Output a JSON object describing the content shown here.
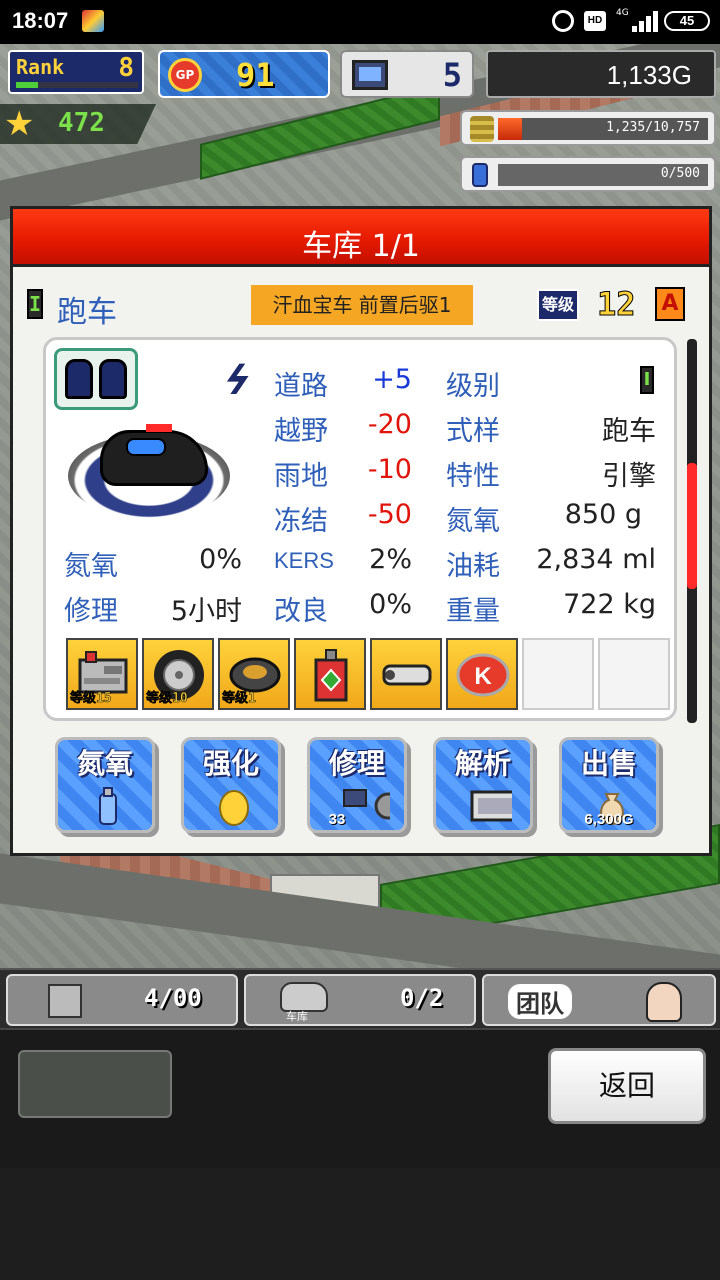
{
  "status_bar": {
    "time": "18:07",
    "hd": "HD",
    "network": "4G",
    "battery": "45"
  },
  "hud": {
    "rank_label": "Rank",
    "rank_value": "8",
    "rank_progress": 0.18,
    "gp_icon": "GP",
    "gp_value": "91",
    "pc_value": "5",
    "money": "1,133G",
    "stars": "472",
    "coins_bar": "1,235/10,757",
    "coins_fraction": 0.115,
    "fuel_bar": "0/500"
  },
  "dialog": {
    "title": "车库 1/1",
    "grade": "I",
    "car_type": "跑车",
    "car_name": "汗血宝车 前置后驱1",
    "level_label": "等级",
    "level_value": "12",
    "rank_letter": "A",
    "stats": {
      "road_label": "道路",
      "road_value": "+5",
      "offroad_label": "越野",
      "offroad_value": "-20",
      "rain_label": "雨地",
      "rain_value": "-10",
      "freeze_label": "冻结",
      "freeze_value": "-50",
      "class_label": "级别",
      "class_value": "I",
      "style_label": "式样",
      "style_value": "跑车",
      "feature_label": "特性",
      "feature_value": "引擎",
      "nitro_label": "氮氧",
      "nitro_value": "850 g",
      "nitro2_label": "氮氧",
      "nitro2_value": "0%",
      "repair_label": "修理",
      "repair_value": "5小时",
      "kers_label": "KERS",
      "kers_value": "2%",
      "improve_label": "改良",
      "improve_value": "0%",
      "fuel_label": "油耗",
      "fuel_value": "2,834 ml",
      "weight_label": "重量",
      "weight_value": "722 kg"
    },
    "parts": [
      {
        "icon": "engine-icon",
        "badge": "等级15"
      },
      {
        "icon": "wheel-icon",
        "badge": "等级10"
      },
      {
        "icon": "tire-part-icon",
        "badge": "等级1"
      },
      {
        "icon": "oil-can-icon",
        "badge": ""
      },
      {
        "icon": "muffler-icon",
        "badge": ""
      },
      {
        "icon": "k-emblem-icon",
        "badge": ""
      }
    ],
    "actions": {
      "nitro": "氮氧",
      "enhance": "强化",
      "repair": "修理",
      "repair_sub": "33",
      "analyze": "解析",
      "sell": "出售",
      "sell_price": "6,300G"
    }
  },
  "bottom_tabs": {
    "storage_value": "4/00",
    "garage_value": "0/2",
    "garage_caption": "车库",
    "team_label": "团队"
  },
  "back_label": "返回",
  "colors": {
    "title_red": "#e61a00",
    "label_blue": "#2f5fb8",
    "positive_blue": "#1a3ad8",
    "negative_red": "#e0140a",
    "name_orange": "#f5a623"
  }
}
